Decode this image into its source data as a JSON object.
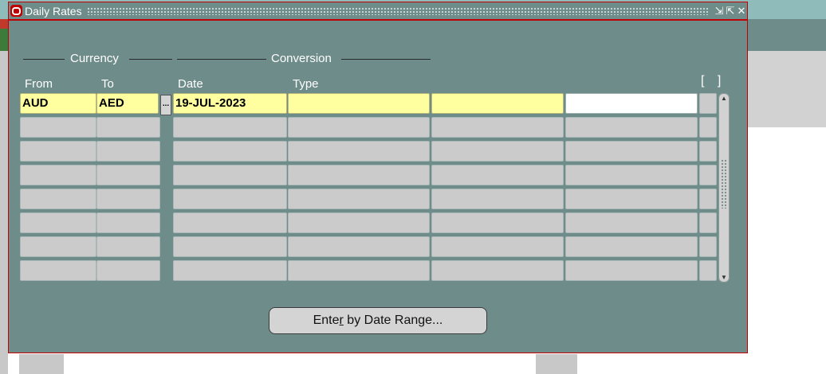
{
  "window": {
    "title": "Daily Rates",
    "controls": [
      "minimize-icon",
      "maximize-icon",
      "close-icon"
    ]
  },
  "groups": {
    "currency": "Currency",
    "conversion": "Conversion"
  },
  "columns": {
    "from": "From",
    "to": "To",
    "date": "Date",
    "type": "Type"
  },
  "rows": [
    {
      "from": "AUD",
      "to": "AED",
      "date": "19-JUL-2023",
      "type": "",
      "col5": "",
      "col6": ""
    },
    {
      "from": "",
      "to": "",
      "date": "",
      "type": "",
      "col5": "",
      "col6": ""
    },
    {
      "from": "",
      "to": "",
      "date": "",
      "type": "",
      "col5": "",
      "col6": ""
    },
    {
      "from": "",
      "to": "",
      "date": "",
      "type": "",
      "col5": "",
      "col6": ""
    },
    {
      "from": "",
      "to": "",
      "date": "",
      "type": "",
      "col5": "",
      "col6": ""
    },
    {
      "from": "",
      "to": "",
      "date": "",
      "type": "",
      "col5": "",
      "col6": ""
    },
    {
      "from": "",
      "to": "",
      "date": "",
      "type": "",
      "col5": "",
      "col6": ""
    },
    {
      "from": "",
      "to": "",
      "date": "",
      "type": "",
      "col5": "",
      "col6": ""
    }
  ],
  "lov_button": "...",
  "descriptive_flex": "[ ]",
  "buttons": {
    "date_range_prefix": "Ente",
    "date_range_mnemonic": "r",
    "date_range_suffix": " by Date Range..."
  },
  "colors": {
    "window_bg": "#6e8c8a",
    "required_field": "#ffffa0",
    "disabled_field": "#cbcbcb",
    "border_accent": "#c00000"
  }
}
